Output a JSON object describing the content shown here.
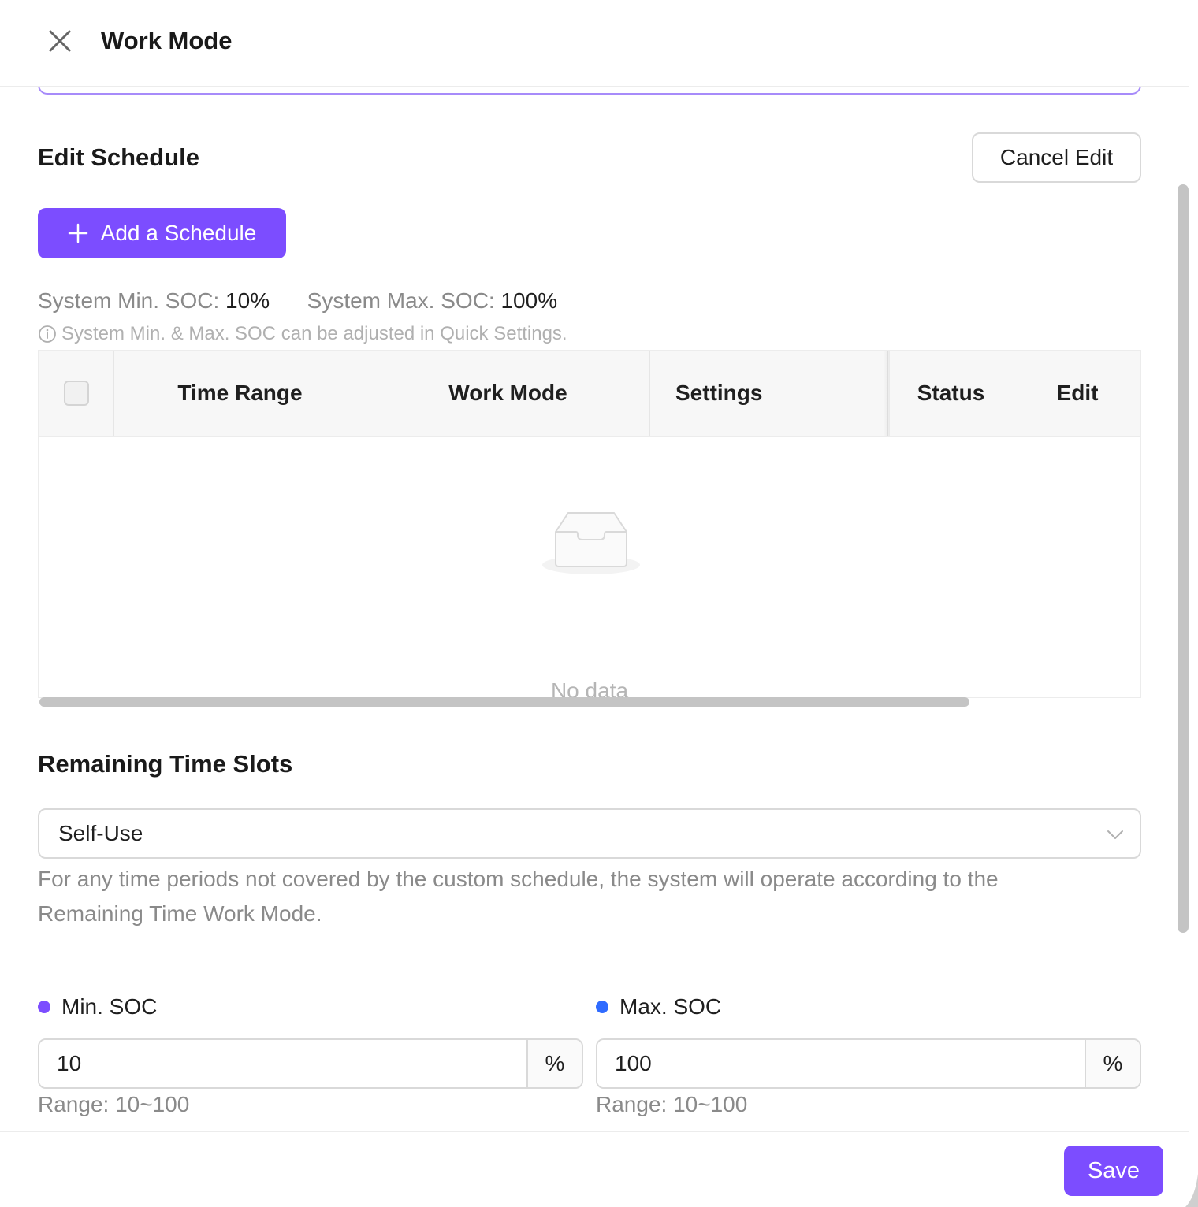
{
  "header": {
    "title": "Work Mode"
  },
  "schedule": {
    "title": "Edit Schedule",
    "cancel_label": "Cancel Edit",
    "add_label": "Add a Schedule",
    "min_soc_label": "System Min. SOC:",
    "min_soc_value": "10%",
    "max_soc_label": "System Max. SOC:",
    "max_soc_value": "100%",
    "hint": "System Min. & Max. SOC can be adjusted in Quick Settings."
  },
  "table": {
    "columns": [
      "Time Range",
      "Work Mode",
      "Settings",
      "Status",
      "Edit"
    ],
    "empty_text": "No data"
  },
  "remaining": {
    "title": "Remaining Time Slots",
    "selected": "Self-Use",
    "description": "For any time periods not covered by the custom schedule, the system will operate according to the Remaining Time Work Mode."
  },
  "min_soc": {
    "label": "Min. SOC",
    "value": "10",
    "unit": "%",
    "range": "Range: 10~100",
    "color": "#7c4dff"
  },
  "max_soc": {
    "label": "Max. SOC",
    "value": "100",
    "unit": "%",
    "range": "Range: 10~100",
    "color": "#2f6bff"
  },
  "footer": {
    "save_label": "Save"
  },
  "colors": {
    "accent": "#7c4dff"
  }
}
